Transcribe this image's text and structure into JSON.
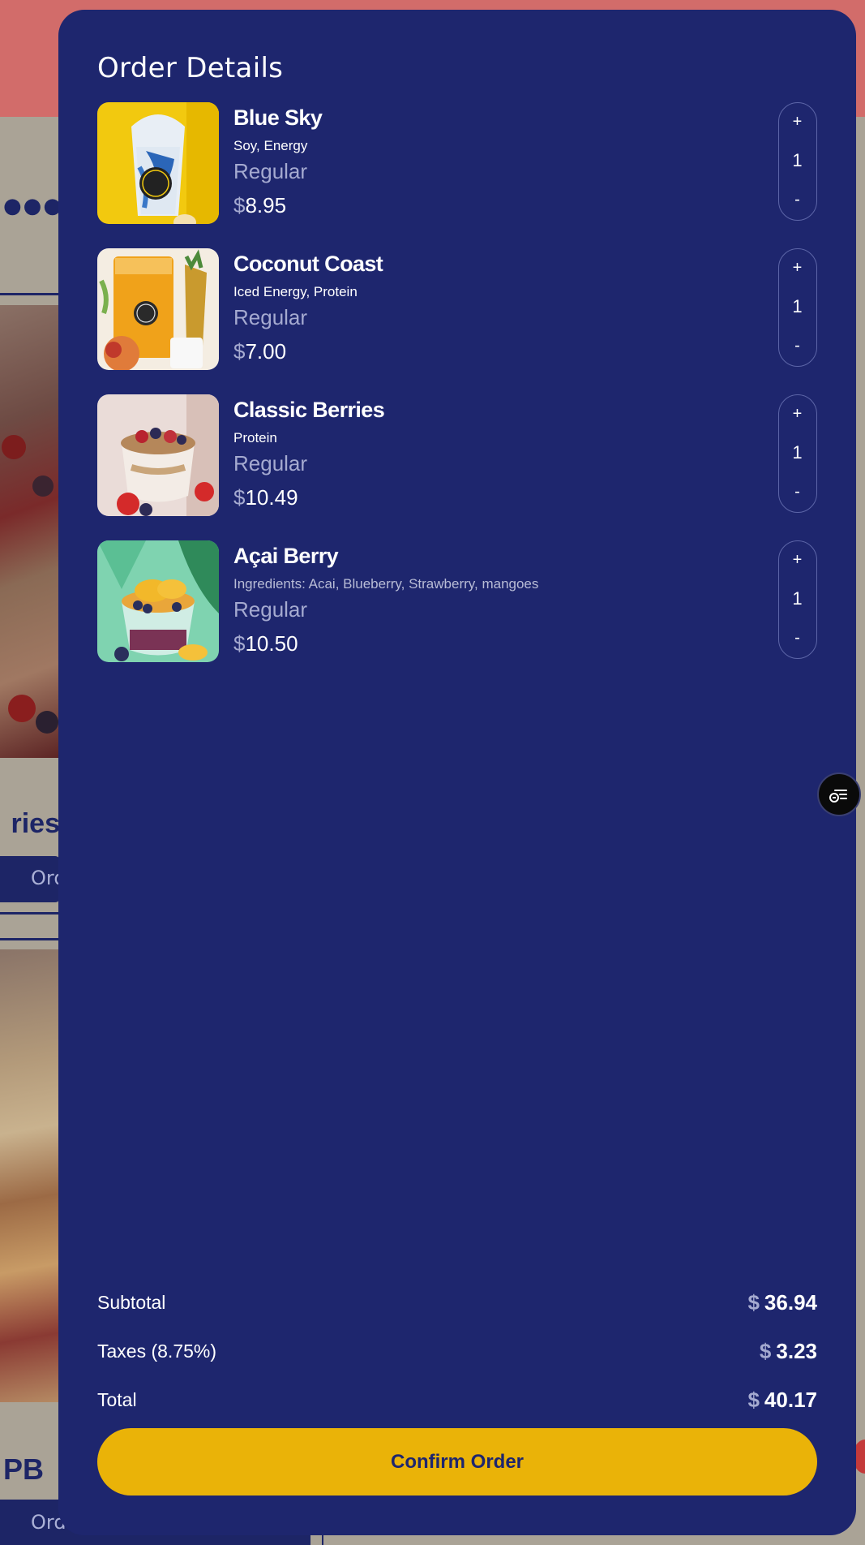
{
  "background": {
    "category_title": "ries",
    "order_button_label": "Order",
    "second_title": "PB",
    "order_button2_label": "Order"
  },
  "order": {
    "title": "Order Details",
    "items": [
      {
        "name": "Blue Sky",
        "details": "Soy, Energy",
        "size": "Regular",
        "currency": "$",
        "price": "8.95",
        "qty": "1",
        "image": "blue-smoothie-cup"
      },
      {
        "name": "Coconut Coast",
        "details": "Iced Energy, Protein",
        "size": "Regular",
        "currency": "$",
        "price": "7.00",
        "qty": "1",
        "image": "orange-drink-with-pineapple"
      },
      {
        "name": "Classic Berries",
        "details": "Protein",
        "size": "Regular",
        "currency": "$",
        "price": "10.49",
        "qty": "1",
        "image": "berry-bowl"
      },
      {
        "name": "Açai Berry",
        "details": "Ingredients: Acai, Blueberry, Strawberry, mangoes",
        "size": "Regular",
        "currency": "$",
        "price": "10.50",
        "qty": "1",
        "image": "acai-mango-bowl"
      }
    ],
    "stepper": {
      "plus": "+",
      "minus": "-"
    },
    "summary": {
      "subtotal_label": "Subtotal",
      "subtotal_currency": "$",
      "subtotal_value": "36.94",
      "taxes_label": "Taxes (8.75%)",
      "taxes_currency": "$",
      "taxes_value": "3.23",
      "total_label": "Total",
      "total_currency": "$",
      "total_value": "40.17"
    },
    "confirm_label": "Confirm Order"
  },
  "colors": {
    "modal_bg": "#1e266e",
    "accent_yellow": "#eab308",
    "header_red": "#d26c6a",
    "muted_text": "#a5aad0"
  },
  "icons": {
    "filter": "filter-list-icon"
  }
}
